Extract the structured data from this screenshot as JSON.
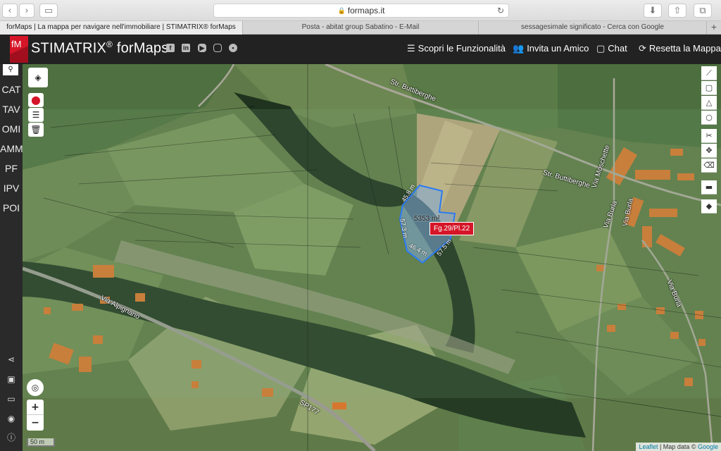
{
  "browser": {
    "url": "formaps.it",
    "tabs": [
      "forMaps | La mappa per navigare nell'immobiliare | STIMATRIX® forMaps",
      "Posta - abitat group Sabatino - E-Mail",
      "sessagesimale significato - Cerca con Google"
    ]
  },
  "app": {
    "logo_text": "fM",
    "brand": "STIMATRIX",
    "brand_mark": "®",
    "brand_suffix": "forMaps",
    "nav": {
      "features": "Scopri le Funzionalità",
      "invite": "Invita un Amico",
      "chat": "Chat",
      "reset": "Resetta la Mappa"
    }
  },
  "sidebar": {
    "items": [
      "CAT",
      "TAV",
      "OMI",
      "AMM",
      "PF",
      "IPV",
      "POI"
    ]
  },
  "map": {
    "parcel_label": "Fg.29/Pl.22",
    "area": "5353 m²",
    "dimensions": [
      "45.8 m",
      "57.3 m",
      "46.4 m",
      "57.5 m"
    ],
    "roads": [
      "Str. Buttiberghe",
      "Str. Buttiberghe",
      "Via Moschette",
      "Via Burla",
      "Via Burla",
      "Via Burla",
      "Via Alpignano",
      "SP177"
    ],
    "zoom_in": "+",
    "zoom_out": "−",
    "scale": "50 m",
    "attribution": {
      "leaflet": "Leaflet",
      "sep": " | Map data © ",
      "google": "Google"
    }
  },
  "colors": {
    "accent": "#d51628",
    "parcel_outline": "#2b7bf2",
    "appbar": "#222222"
  }
}
